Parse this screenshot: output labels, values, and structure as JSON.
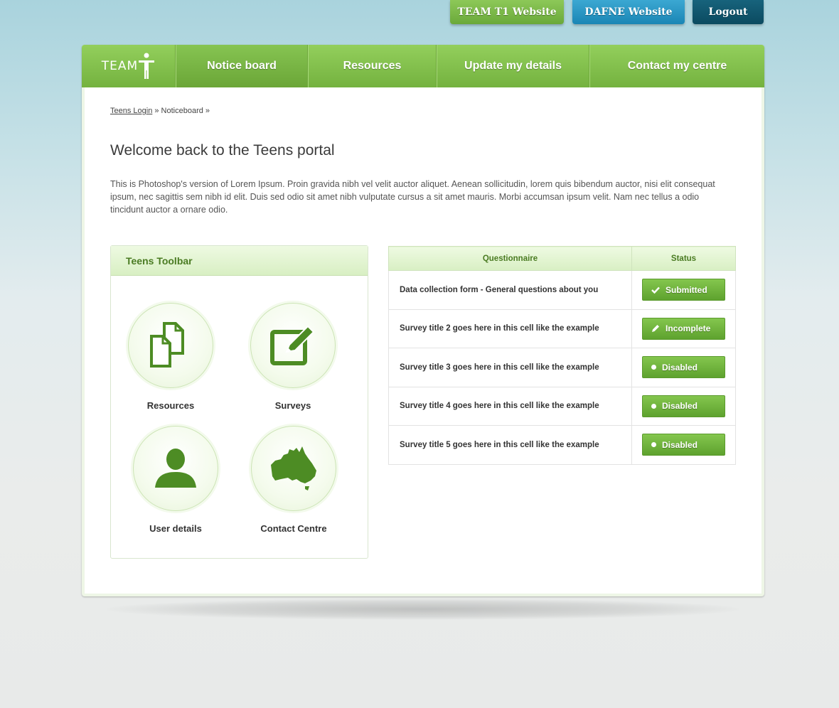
{
  "topbar": {
    "team_label": "TEAM T1 Website",
    "dafne_label": "DAFNE Website",
    "logout_label": "Logout"
  },
  "nav": {
    "logo_text": "TEAM",
    "items": [
      {
        "label": "Notice board"
      },
      {
        "label": "Resources"
      },
      {
        "label": "Update my details"
      },
      {
        "label": "Contact my centre"
      }
    ]
  },
  "breadcrumb": {
    "link": "Teens Login",
    "rest": " » Noticeboard »"
  },
  "page": {
    "title": "Welcome back to the Teens portal",
    "intro": "This is Photoshop's version  of Lorem Ipsum. Proin gravida nibh vel velit auctor aliquet. Aenean sollicitudin, lorem quis bibendum auctor, nisi elit consequat ipsum, nec sagittis sem nibh id elit. Duis sed odio sit amet nibh vulputate cursus a sit amet mauris. Morbi accumsan ipsum velit. Nam nec tellus a odio tincidunt auctor a ornare odio."
  },
  "toolbar": {
    "title": "Teens Toolbar",
    "tools": [
      {
        "label": "Resources",
        "icon": "documents-icon"
      },
      {
        "label": "Surveys",
        "icon": "edit-icon"
      },
      {
        "label": "User details",
        "icon": "user-icon"
      },
      {
        "label": "Contact Centre",
        "icon": "australia-map-icon"
      }
    ]
  },
  "table": {
    "col_questionnaire": "Questionnaire",
    "col_status": "Status",
    "rows": [
      {
        "name": "Data collection form - General questions about you",
        "status": "Submitted",
        "icon": "check-icon"
      },
      {
        "name": "Survey title 2 goes here in this cell like the example",
        "status": "Incomplete",
        "icon": "pencil-icon"
      },
      {
        "name": "Survey title 3 goes here in this cell like the example",
        "status": "Disabled",
        "icon": "dot-icon"
      },
      {
        "name": "Survey title 4 goes here in this cell like the example",
        "status": "Disabled",
        "icon": "dot-icon"
      },
      {
        "name": "Survey title 5 goes here in this cell like the example",
        "status": "Disabled",
        "icon": "dot-icon"
      }
    ]
  },
  "colors": {
    "brand_green": "#7bb944",
    "dafne_blue": "#2a97c4",
    "logout_teal": "#0f5670"
  }
}
